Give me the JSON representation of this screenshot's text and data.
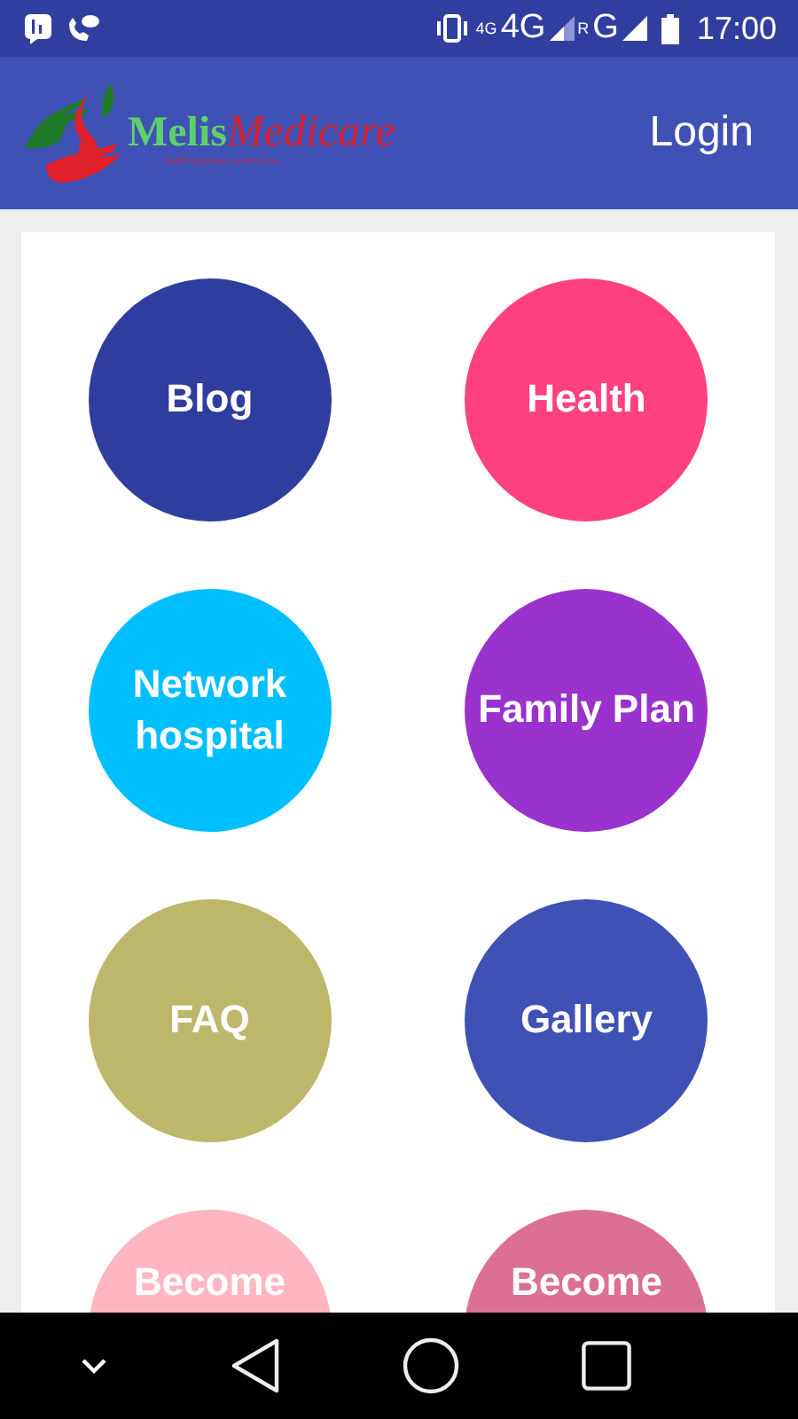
{
  "status_bar": {
    "network_small": "4G",
    "network": "4G",
    "roaming": "R",
    "network_2": "G",
    "time": "17:00"
  },
  "app_bar": {
    "brand_first": "Melis",
    "brand_second": "Medicare",
    "tagline": "... health is precious, secure it now.",
    "login": "Login"
  },
  "tiles": [
    {
      "label": "Blog",
      "color": "#2f3d9e"
    },
    {
      "label": "Health",
      "color": "#ff4081"
    },
    {
      "label": "Network hospital",
      "color": "#00bfff"
    },
    {
      "label": "Family Plan",
      "color": "#9a32cd"
    },
    {
      "label": "FAQ",
      "color": "#bdb76b"
    },
    {
      "label": "Gallery",
      "color": "#3f51b5"
    },
    {
      "label": "Become",
      "color": "#ffb6c1"
    },
    {
      "label": "Become",
      "color": "#db7093"
    }
  ]
}
